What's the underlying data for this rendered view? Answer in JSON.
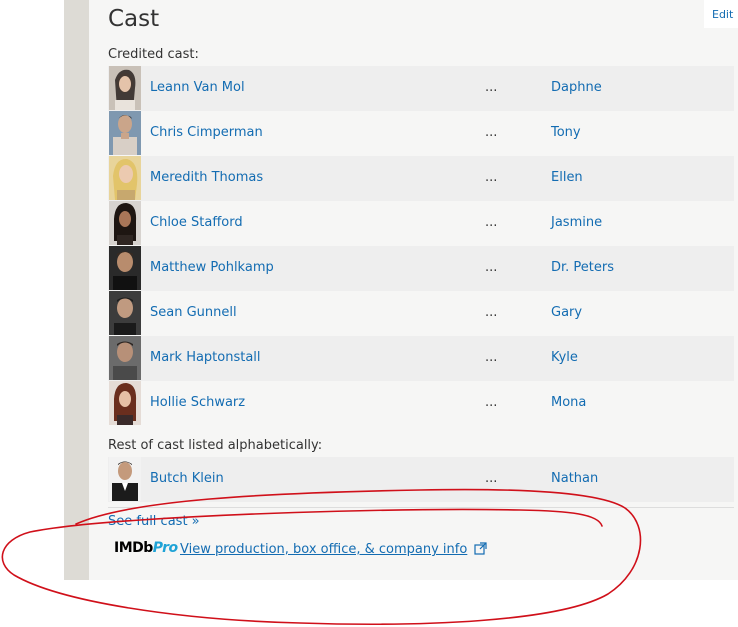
{
  "page": {
    "edit_label": "Edit",
    "title": "Cast"
  },
  "credited_label": "Credited cast:",
  "credited_cast": [
    {
      "name": "Leann Van Mol",
      "separator": "...",
      "character": "Daphne"
    },
    {
      "name": "Chris Cimperman",
      "separator": "...",
      "character": "Tony"
    },
    {
      "name": "Meredith Thomas",
      "separator": "...",
      "character": "Ellen"
    },
    {
      "name": "Chloe Stafford",
      "separator": "...",
      "character": "Jasmine"
    },
    {
      "name": "Matthew Pohlkamp",
      "separator": "...",
      "character": "Dr. Peters"
    },
    {
      "name": "Sean Gunnell",
      "separator": "...",
      "character": "Gary"
    },
    {
      "name": "Mark Haptonstall",
      "separator": "...",
      "character": "Kyle"
    },
    {
      "name": "Hollie Schwarz",
      "separator": "...",
      "character": "Mona"
    }
  ],
  "rest_label": "Rest of cast listed alphabetically:",
  "rest_cast": [
    {
      "name": "Butch Klein",
      "separator": "...",
      "character": "Nathan"
    }
  ],
  "see_full_cast": "See full cast »",
  "imdbpro": {
    "logo_imdb": "IMDb",
    "logo_pro": "Pro",
    "link_text": "View production, box office, & company info"
  },
  "colors": {
    "link": "#136cb2",
    "annotation": "#d0101a",
    "pro_accent": "#1fa3d6"
  },
  "icons": [
    "headshot-photo",
    "external-link-icon",
    "imdbpro-logo"
  ]
}
